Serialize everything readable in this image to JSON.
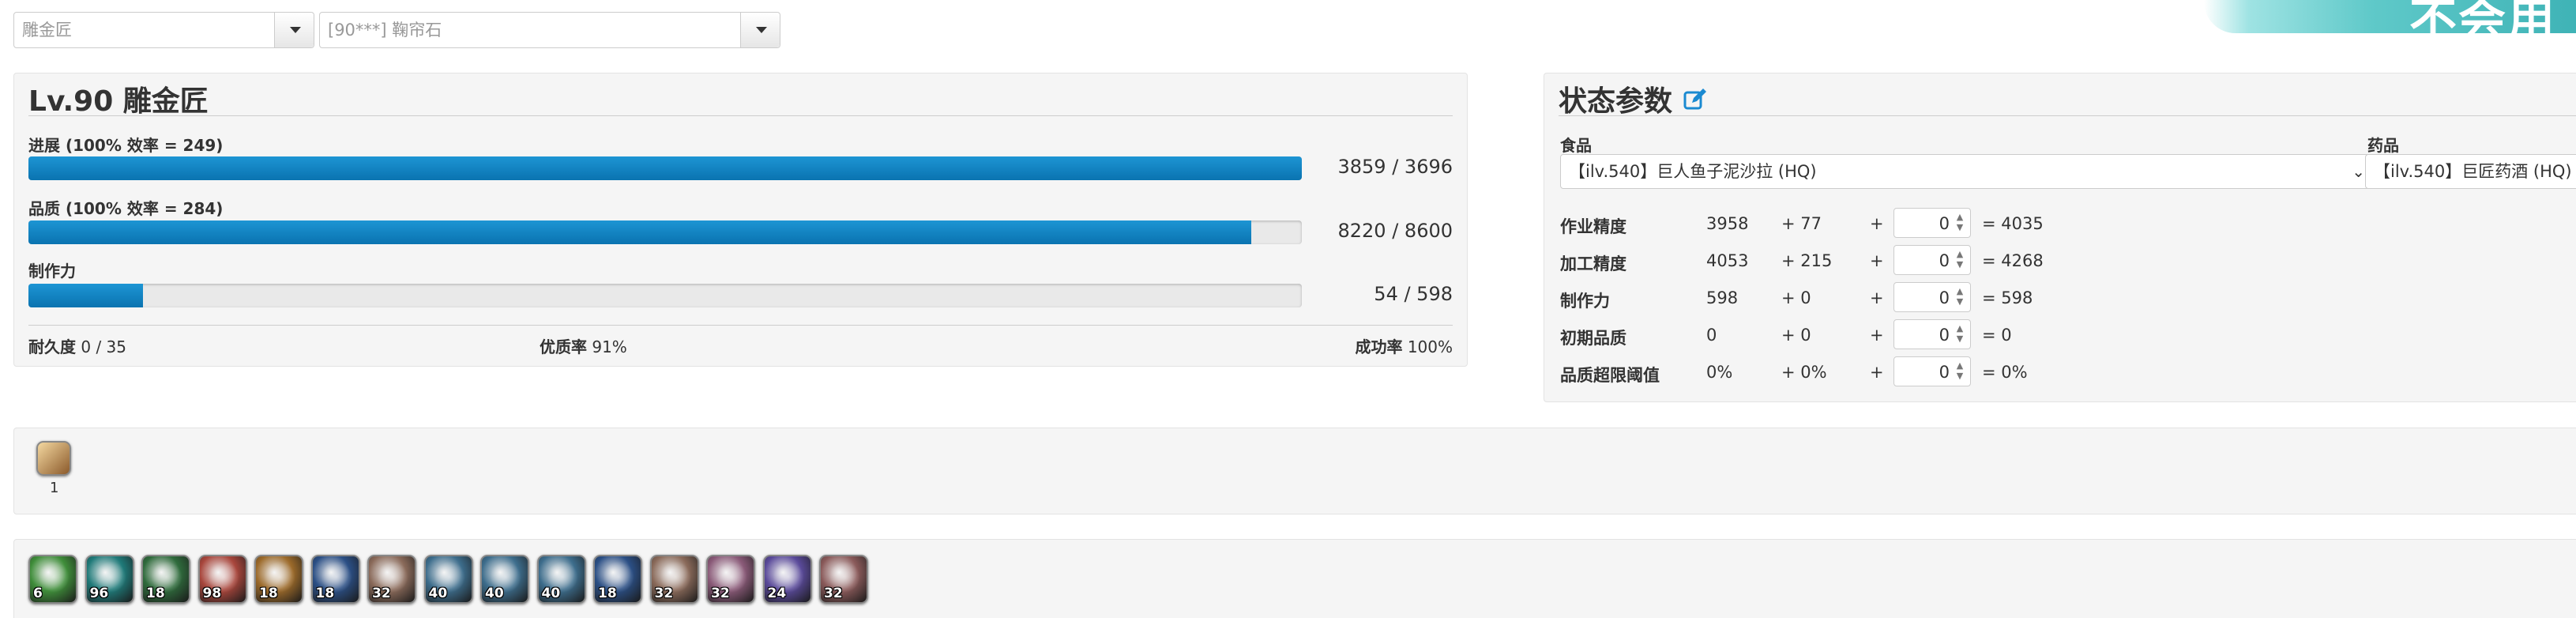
{
  "top": {
    "job_select": "雕金匠",
    "recipe_select": "[90***] 鞠帘石"
  },
  "banner": {
    "text": "不会用修"
  },
  "craft": {
    "title": "Lv.90 雕金匠",
    "progress": {
      "label": "进展 (100% 效率 = 249)",
      "value": "3859 / 3696",
      "fill": 1.0
    },
    "quality": {
      "label": "品质 (100% 效率 = 284)",
      "value": "8220 / 8600",
      "fill": 0.96
    },
    "cp": {
      "label": "制作力",
      "value": "54 / 598",
      "fill": 0.09
    },
    "durability_label": "耐久度",
    "durability_value": "0 / 35",
    "hq_label": "优质率",
    "hq_value": "91%",
    "success_label": "成功率",
    "success_value": "100%"
  },
  "status": {
    "title": "状态参数",
    "food_label": "食品",
    "food_value": "【ilv.540】巨人鱼子泥沙拉 (HQ)",
    "medicine_label": "药品",
    "medicine_value": "【ilv.540】巨匠药酒 (HQ)",
    "rows": [
      {
        "name": "作业精度",
        "base": "3958",
        "bonus": "+ 77",
        "plus": "+",
        "input": "0",
        "total": "= 4035"
      },
      {
        "name": "加工精度",
        "base": "4053",
        "bonus": "+ 215",
        "plus": "+",
        "input": "0",
        "total": "= 4268"
      },
      {
        "name": "制作力",
        "base": "598",
        "bonus": "+ 0",
        "plus": "+",
        "input": "0",
        "total": "= 598"
      },
      {
        "name": "初期品质",
        "base": "0",
        "bonus": "+ 0",
        "plus": "+",
        "input": "0",
        "total": "= 0"
      },
      {
        "name": "品质超限阈值",
        "base": "0%",
        "bonus": "+ 0%",
        "plus": "+",
        "input": "0",
        "total": "= 0%"
      }
    ]
  },
  "buffs": [
    {
      "icon": "crafter-buff-icon",
      "count": "1"
    }
  ],
  "skills": [
    {
      "icon": "muscle-memory-icon",
      "level": "6",
      "color": "#3f8d3a"
    },
    {
      "icon": "veneration-icon",
      "level": "96",
      "color": "#1f7a79"
    },
    {
      "icon": "waste-not-icon",
      "level": "18",
      "color": "#2f6b3c"
    },
    {
      "icon": "final-appraisal-icon",
      "level": "98",
      "color": "#a8463c"
    },
    {
      "icon": "basic-synthesis-icon",
      "level": "18",
      "color": "#9c6a2a"
    },
    {
      "icon": "manipulation-icon",
      "level": "18",
      "color": "#2b4f85"
    },
    {
      "icon": "basic-touch-icon",
      "level": "32",
      "color": "#8a6a5a"
    },
    {
      "icon": "standard-touch-icon",
      "level": "40",
      "color": "#3d6d8c"
    },
    {
      "icon": "advanced-touch-icon",
      "level": "40",
      "color": "#3d6d8c"
    },
    {
      "icon": "prudent-touch-icon",
      "level": "40",
      "color": "#3d6d8c"
    },
    {
      "icon": "innovation-icon",
      "level": "18",
      "color": "#2b4f85"
    },
    {
      "icon": "preparatory-touch-icon",
      "level": "32",
      "color": "#8a6a5a"
    },
    {
      "icon": "great-strides-icon",
      "level": "32",
      "color": "#8a5a78"
    },
    {
      "icon": "trained-finesse-icon",
      "level": "24",
      "color": "#5a4a9a"
    },
    {
      "icon": "byregot-blessing-icon",
      "level": "32",
      "color": "#8a5a5a"
    }
  ]
}
